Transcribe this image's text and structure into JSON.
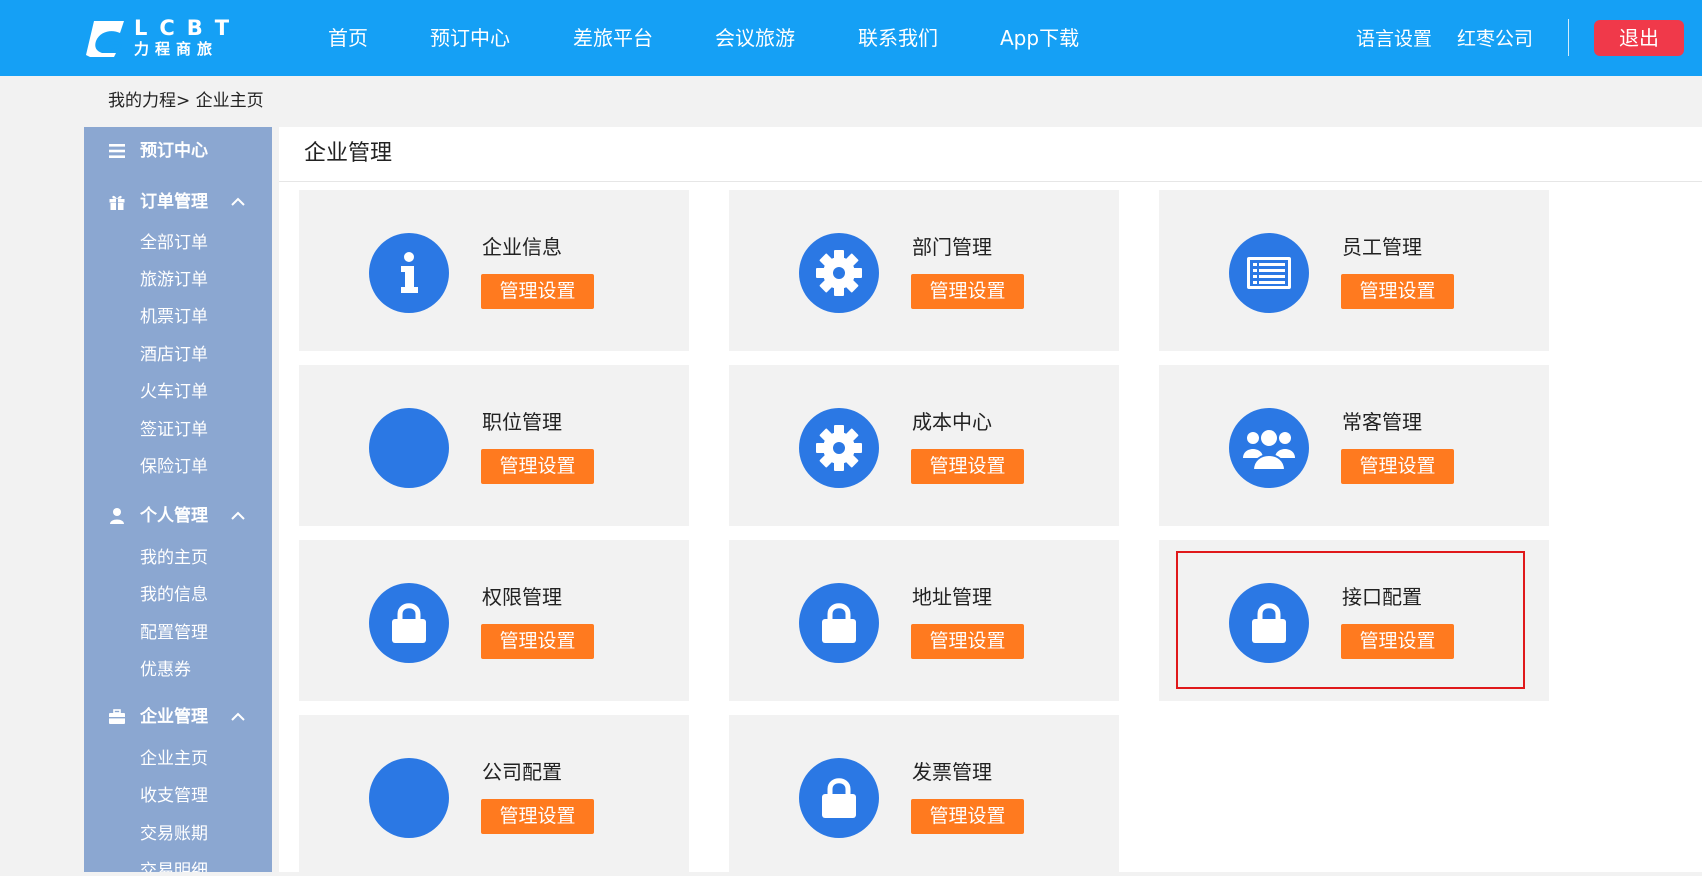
{
  "header": {
    "logo_letters": "LCBT",
    "logo_cn": "力程商旅",
    "nav": [
      "首页",
      "预订中心",
      "差旅平台",
      "会议旅游",
      "联系我们",
      "App下载"
    ],
    "language": "语言设置",
    "company": "红枣公司",
    "logout": "退出"
  },
  "breadcrumb": "我的力程> 企业主页",
  "sidebar": {
    "sections": [
      {
        "label": "预订中心",
        "icon": "menu-icon",
        "items": []
      },
      {
        "label": "订单管理",
        "icon": "gift-icon",
        "items": [
          "全部订单",
          "旅游订单",
          "机票订单",
          "酒店订单",
          "火车订单",
          "签证订单",
          "保险订单"
        ]
      },
      {
        "label": "个人管理",
        "icon": "user-icon",
        "items": [
          "我的主页",
          "我的信息",
          "配置管理",
          "优惠券"
        ]
      },
      {
        "label": "企业管理",
        "icon": "briefcase-icon",
        "items": [
          "企业主页",
          "收支管理",
          "交易账期",
          "交易明细"
        ]
      }
    ]
  },
  "main": {
    "title": "企业管理",
    "button_label": "管理设置",
    "cards": [
      {
        "title": "企业信息",
        "icon": "info-icon"
      },
      {
        "title": "部门管理",
        "icon": "gear-icon"
      },
      {
        "title": "员工管理",
        "icon": "list-card-icon"
      },
      {
        "title": "职位管理",
        "icon": "blank-icon"
      },
      {
        "title": "成本中心",
        "icon": "gear-icon"
      },
      {
        "title": "常客管理",
        "icon": "users-icon"
      },
      {
        "title": "权限管理",
        "icon": "lock-icon"
      },
      {
        "title": "地址管理",
        "icon": "lock-icon"
      },
      {
        "title": "接口配置",
        "icon": "lock-icon"
      },
      {
        "title": "公司配置",
        "icon": "blank-icon"
      },
      {
        "title": "发票管理",
        "icon": "lock-icon"
      }
    ]
  },
  "colors": {
    "header_bg": "#15a0f5",
    "sidebar_bg": "#8ba7d1",
    "icon_circle": "#2b78e4",
    "button_bg": "#ff7a1f",
    "logout_bg": "#f0394a",
    "highlight_border": "#e0191b"
  }
}
